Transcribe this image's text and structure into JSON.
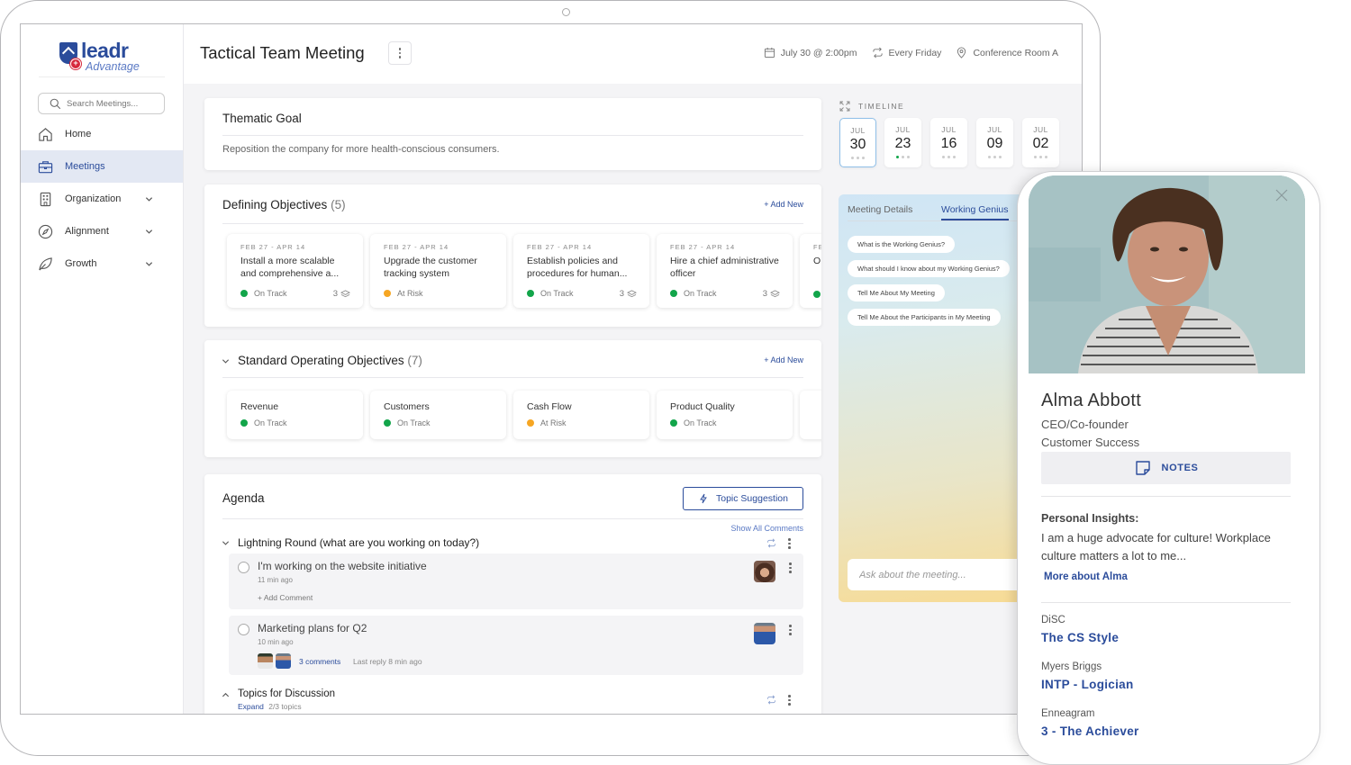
{
  "brand": {
    "name": "leadr",
    "sub": "Advantage"
  },
  "sidebar": {
    "search_placeholder": "Search Meetings...",
    "items": [
      {
        "label": "Home",
        "icon": "home-icon"
      },
      {
        "label": "Meetings",
        "icon": "briefcase-icon",
        "active": true
      },
      {
        "label": "Organization",
        "icon": "building-icon",
        "expandable": true
      },
      {
        "label": "Alignment",
        "icon": "compass-icon",
        "expandable": true
      },
      {
        "label": "Growth",
        "icon": "leaf-icon",
        "expandable": true
      }
    ]
  },
  "header": {
    "title": "Tactical Team Meeting",
    "date": "July 30 @ 2:00pm",
    "recurrence": "Every Friday",
    "location": "Conference Room A"
  },
  "thematic_goal": {
    "title": "Thematic Goal",
    "text": "Reposition the company for more health-conscious consumers."
  },
  "defining_objectives": {
    "title": "Defining Objectives",
    "count": "(5)",
    "add_label": "+ Add New",
    "items": [
      {
        "date": "FEB 27 - APR 14",
        "name": "Install a more scalable and comprehensive a...",
        "status": "On Track",
        "status_color": "#12a54a",
        "count": "3"
      },
      {
        "date": "FEB 27 - APR 14",
        "name": "Upgrade the customer tracking system",
        "status": "At Risk",
        "status_color": "#f6a623",
        "count": ""
      },
      {
        "date": "FEB 27 - APR 14",
        "name": "Establish policies and procedures for human...",
        "status": "On Track",
        "status_color": "#12a54a",
        "count": "3"
      },
      {
        "date": "FEB 27 - APR 14",
        "name": "Hire a chief administrative officer",
        "status": "On Track",
        "status_color": "#12a54a",
        "count": "3"
      },
      {
        "date": "FE",
        "name": "O",
        "status": "",
        "status_color": "#12a54a",
        "count": ""
      }
    ]
  },
  "sop_objectives": {
    "title": "Standard Operating Objectives",
    "count": "(7)",
    "add_label": "+ Add New",
    "items": [
      {
        "name": "Revenue",
        "status": "On Track",
        "status_color": "#12a54a"
      },
      {
        "name": "Customers",
        "status": "On Track",
        "status_color": "#12a54a"
      },
      {
        "name": "Cash Flow",
        "status": "At Risk",
        "status_color": "#f6a623"
      },
      {
        "name": "Product Quality",
        "status": "On Track",
        "status_color": "#12a54a"
      }
    ]
  },
  "agenda": {
    "title": "Agenda",
    "topic_suggestion": "Topic Suggestion",
    "show_all_comments": "Show All Comments",
    "sections": [
      {
        "title": "Lightning Round (what are you working on today?)",
        "items": [
          {
            "title": "I'm working on the website initiative",
            "time": "11 min ago",
            "add_comment": "+ Add Comment"
          },
          {
            "title": "Marketing plans for Q2",
            "time": "10 min ago",
            "comments": "3 comments",
            "last_reply": "Last reply 8 min ago"
          }
        ]
      },
      {
        "title": "Topics for Discussion",
        "expand": "Expand",
        "progress": "2/3 topics"
      }
    ]
  },
  "timeline": {
    "label": "TIMELINE",
    "dates": [
      {
        "month": "JUL",
        "day": "30",
        "active": true
      },
      {
        "month": "JUL",
        "day": "23",
        "has_green": true
      },
      {
        "month": "JUL",
        "day": "16"
      },
      {
        "month": "JUL",
        "day": "09"
      },
      {
        "month": "JUL",
        "day": "02"
      }
    ]
  },
  "ai_panel": {
    "tabs": [
      "Meeting Details",
      "Working Genius"
    ],
    "active_tab": "Working Genius",
    "suggestions": [
      "What is the Working Genius?",
      "What should I know about my Working Genius?",
      "Tell Me About My Meeting",
      "Tell Me About the Participants in My Meeting"
    ],
    "input_placeholder": "Ask about the meeting..."
  },
  "profile": {
    "name": "Alma Abbott",
    "role": "CEO/Co-founder",
    "department": "Customer Success",
    "notes_label": "NOTES",
    "insights_heading": "Personal Insights:",
    "insights_text": "I am a huge advocate for culture! Workplace culture matters a lot to me...",
    "more_link": "More about Alma",
    "assessments": [
      {
        "label": "DiSC",
        "value": "The CS Style"
      },
      {
        "label": "Myers Briggs",
        "value": "INTP - Logician"
      },
      {
        "label": "Enneagram",
        "value": "3 - The Achiever"
      }
    ]
  }
}
